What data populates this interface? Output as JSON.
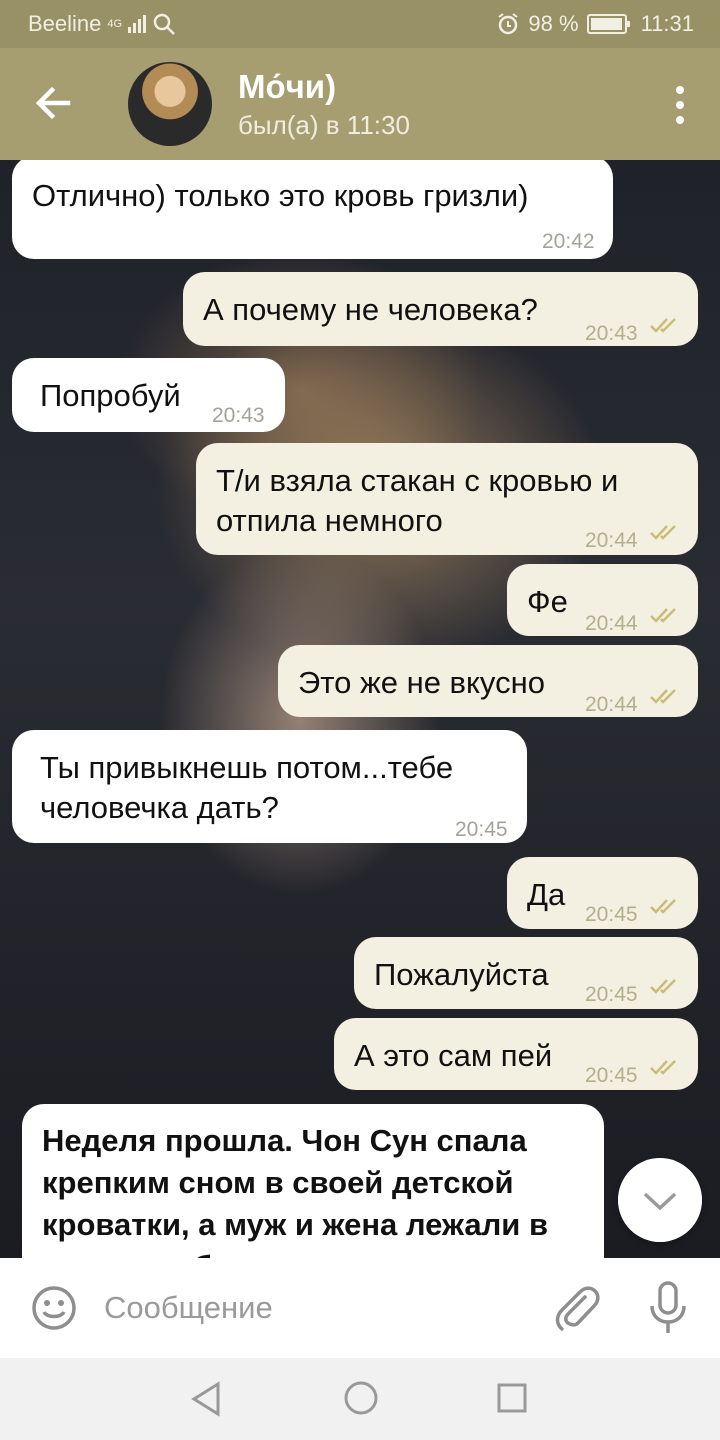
{
  "status_bar": {
    "carrier": "Beeline",
    "network": "4G",
    "battery": "98 %",
    "battery_level": 0.98,
    "time": "11:31"
  },
  "header": {
    "contact_name": "Мо́чи)",
    "last_seen": "был(а) в 11:30"
  },
  "messages": [
    {
      "dir": "in",
      "text": "Отлично) только это кровь гризли)",
      "time": "20:42"
    },
    {
      "dir": "out",
      "text": "А почему не человека?",
      "time": "20:43",
      "read": true
    },
    {
      "dir": "in",
      "text": "Попробуй",
      "time": "20:43"
    },
    {
      "dir": "out",
      "text": "Т/и взяла стакан с кровью и отпила немного",
      "time": "20:44",
      "read": true
    },
    {
      "dir": "out",
      "text": "Фе",
      "time": "20:44",
      "read": true
    },
    {
      "dir": "out",
      "text": "Это же не вкусно",
      "time": "20:44",
      "read": true
    },
    {
      "dir": "in",
      "text": "Ты привыкнешь потом...тебе человечка дать?",
      "time": "20:45"
    },
    {
      "dir": "out",
      "text": "Да",
      "time": "20:45",
      "read": true
    },
    {
      "dir": "out",
      "text": "Пожалуйста",
      "time": "20:45",
      "read": true
    },
    {
      "dir": "out",
      "text": "А это сам пей",
      "time": "20:45",
      "read": true
    },
    {
      "dir": "in",
      "text": "Неделя прошла. Чон Сун спала крепким сном в своей детской кроватки, а муж и жена лежали в постеле обнимая друг друга"
    }
  ],
  "input": {
    "placeholder": "Сообщение",
    "value": ""
  },
  "icons": {
    "back": "arrow-left-icon",
    "menu": "more-vertical-icon",
    "scroll": "chevron-down-icon",
    "emoji": "smiley-icon",
    "attach": "paperclip-icon",
    "mic": "microphone-icon",
    "read": "double-check-icon"
  },
  "colors": {
    "header": "#a69e70",
    "statusbar": "#989166",
    "outgoing_bubble": "#f3f0e1",
    "incoming_bubble": "#ffffff",
    "check": "#c9bd75"
  }
}
